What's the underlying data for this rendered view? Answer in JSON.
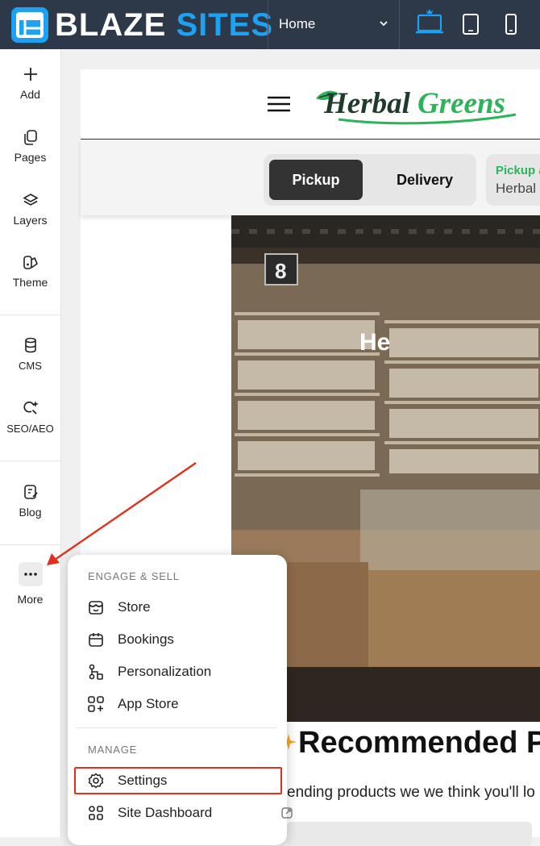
{
  "topbar": {
    "logo_blaze": "BLAZE",
    "logo_sites": "SITES",
    "page_select": "Home",
    "devices": [
      "desktop-icon",
      "tablet-icon",
      "mobile-icon"
    ],
    "active_device": "desktop"
  },
  "sidebar": {
    "items": [
      {
        "label": "Add",
        "icon": "plus-icon"
      },
      {
        "label": "Pages",
        "icon": "pages-icon"
      },
      {
        "label": "Layers",
        "icon": "layers-icon"
      },
      {
        "label": "Theme",
        "icon": "theme-icon"
      },
      {
        "label": "CMS",
        "icon": "database-icon"
      },
      {
        "label": "SEO/AEO",
        "icon": "seo-sparkle-icon"
      },
      {
        "label": "Blog",
        "icon": "blog-icon"
      },
      {
        "label": "More",
        "icon": "more-dots-icon"
      }
    ]
  },
  "site": {
    "logo": "Herbal Greens",
    "order_toggle": {
      "pickup": "Pickup",
      "delivery": "Delivery",
      "selected": "Pickup"
    },
    "pickup_card": {
      "title": "Pickup a",
      "location": "Herbal"
    },
    "hero_text": "He",
    "recommended_title": "Recommended P",
    "recommended_subtitle": "ending products we we think you'll lo"
  },
  "more_menu": {
    "section_engage": "ENGAGE & SELL",
    "engage_items": [
      {
        "label": "Store",
        "icon": "store-icon"
      },
      {
        "label": "Bookings",
        "icon": "calendar-icon"
      },
      {
        "label": "Personalization",
        "icon": "personalization-icon"
      },
      {
        "label": "App Store",
        "icon": "app-store-icon"
      }
    ],
    "section_manage": "MANAGE",
    "manage_items": [
      {
        "label": "Settings",
        "icon": "gear-icon",
        "highlighted": true
      },
      {
        "label": "Site Dashboard",
        "icon": "dashboard-icon"
      }
    ]
  },
  "colors": {
    "topbar": "#2d3848",
    "brand_blue": "#1da1f2",
    "highlight_red": "#e0311f",
    "herbal_green": "#2db35a",
    "herbal_dark": "#1f3b2c"
  }
}
